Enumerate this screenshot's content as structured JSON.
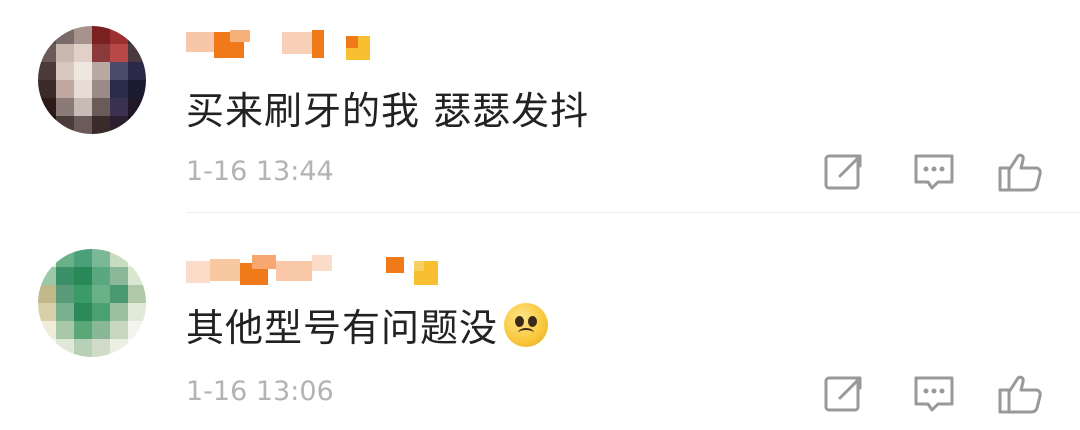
{
  "comments": [
    {
      "text": "买来刷牙的我 瑟瑟发抖",
      "time": "1-16 13:44",
      "has_emoji": false
    },
    {
      "text": "其他型号有问题没",
      "time": "1-16 13:06",
      "has_emoji": true,
      "emoji_icon": "pleading-face-icon"
    }
  ],
  "icons": {
    "share": "share-icon",
    "reply": "comment-icon",
    "like": "thumbs-up-icon"
  },
  "colors": {
    "text": "#222222",
    "meta": "#b3b3b3",
    "icon": "#999999",
    "divider": "#eeeeee",
    "accent_orange": "#f07a1a",
    "accent_yellow": "#f8c030"
  }
}
